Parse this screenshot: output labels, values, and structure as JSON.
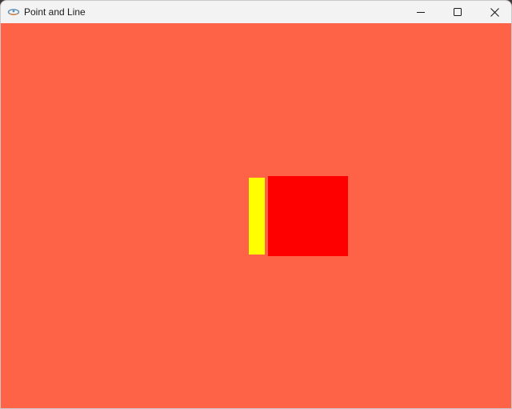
{
  "window": {
    "title": "Point and Line",
    "app_icon": "java-icon",
    "controls": {
      "minimize_icon": "minimize-icon",
      "maximize_icon": "maximize-icon",
      "close_icon": "close-icon"
    }
  },
  "canvas": {
    "background_color": "#ff6347",
    "shapes": [
      {
        "name": "yellow-rectangle",
        "color": "#ffff00"
      },
      {
        "name": "red-square",
        "color": "#ff0000"
      }
    ]
  }
}
